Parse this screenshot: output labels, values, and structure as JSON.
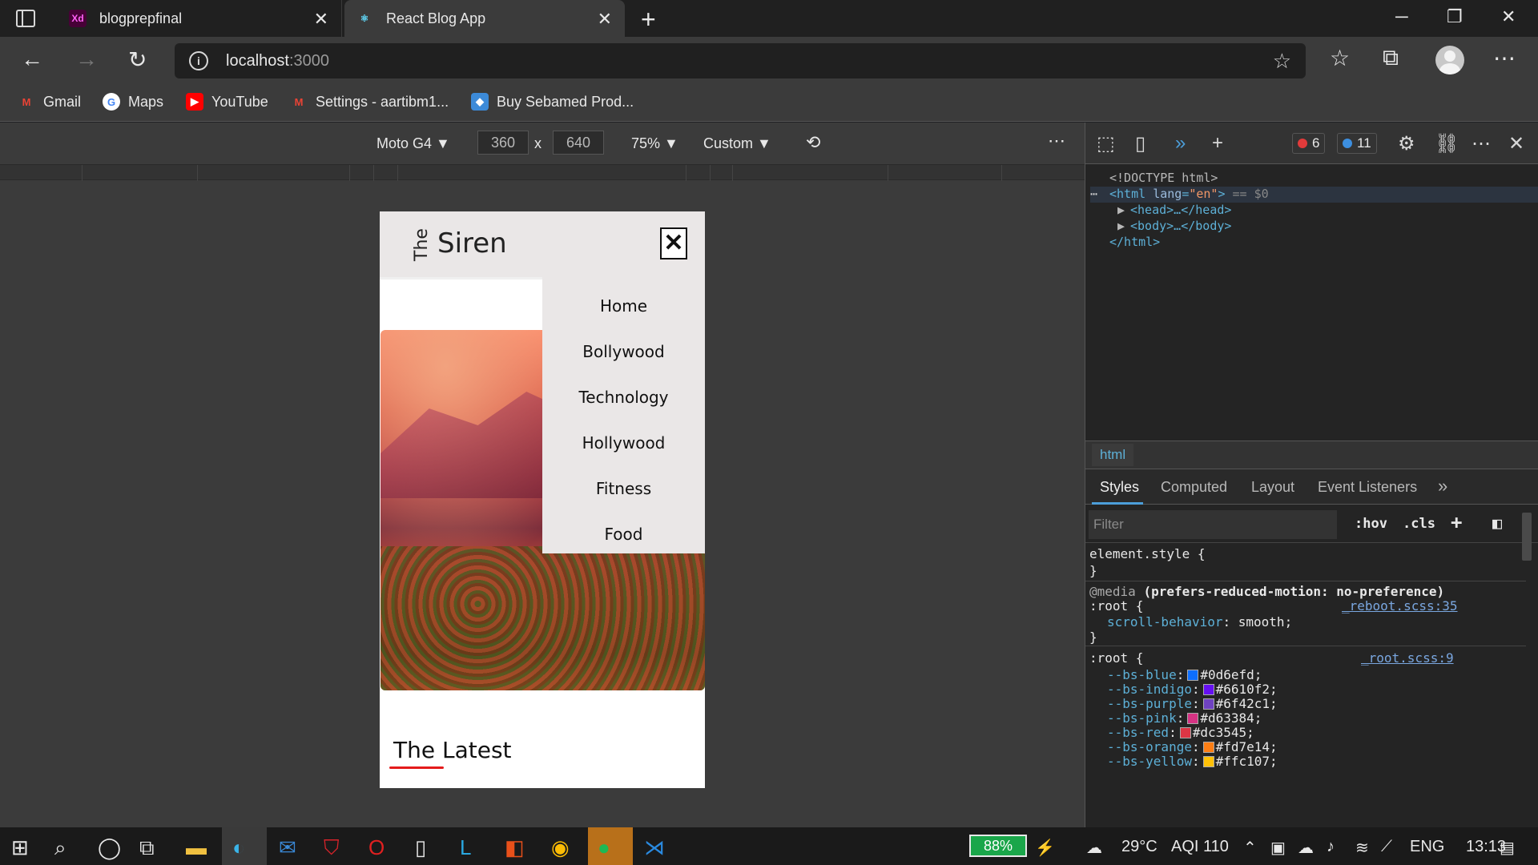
{
  "browser": {
    "tabs": [
      {
        "label": "blogprepfinal",
        "icon": "adobe-xd-icon",
        "icon_text": "Xd"
      },
      {
        "label": "React Blog App",
        "icon": "react-icon"
      }
    ],
    "url_host": "localhost",
    "url_port": ":3000",
    "bookmarks": [
      {
        "label": "Gmail",
        "icon": "gmail-icon"
      },
      {
        "label": "Maps",
        "icon": "google-icon"
      },
      {
        "label": "YouTube",
        "icon": "youtube-icon"
      },
      {
        "label": "Settings - aartibm1...",
        "icon": "gmail-icon"
      },
      {
        "label": "Buy Sebamed Prod...",
        "icon": "shop-icon"
      }
    ]
  },
  "device_toolbar": {
    "device": "Moto G4",
    "width": "360",
    "height": "640",
    "zoom": "75%",
    "throttle": "Custom"
  },
  "page": {
    "logo_the": "The",
    "logo_siren": "Siren",
    "close_symbol": "✕",
    "menu_items": [
      "Home",
      "Bollywood",
      "Technology",
      "Hollywood",
      "Fitness",
      "Food"
    ],
    "section_title": "The Latest"
  },
  "devtools": {
    "error_count": "6",
    "message_count": "11",
    "dom": {
      "doctype": "<!DOCTYPE html>",
      "html_open_tag": "<html",
      "html_attr_name": "lang",
      "html_attr_value": "\"en\"",
      "html_close_bracket": ">",
      "selected_marker": "== $0",
      "head": "<head>…</head>",
      "body": "<body>…</body>",
      "html_close": "</html>"
    },
    "breadcrumb": "html",
    "subtabs": [
      "Styles",
      "Computed",
      "Layout",
      "Event Listeners"
    ],
    "filter_placeholder": "Filter",
    "hov": ":hov",
    "cls": ".cls",
    "styles": {
      "element_style": "element.style {",
      "close_brace": "}",
      "media_at": "@media",
      "media_query": "(prefers-reduced-motion: no-preference)",
      "root_selector": ":root {",
      "reboot_link": "_reboot.scss:35",
      "scroll_prop": "scroll-behavior",
      "scroll_val": "smooth;",
      "root_link": "_root.scss:9",
      "vars": [
        {
          "name": "--bs-blue",
          "value": "#0d6efd;",
          "color": "#0d6efd"
        },
        {
          "name": "--bs-indigo",
          "value": "#6610f2;",
          "color": "#6610f2"
        },
        {
          "name": "--bs-purple",
          "value": "#6f42c1;",
          "color": "#6f42c1"
        },
        {
          "name": "--bs-pink",
          "value": "#d63384;",
          "color": "#d63384"
        },
        {
          "name": "--bs-red",
          "value": "#dc3545;",
          "color": "#dc3545"
        },
        {
          "name": "--bs-orange",
          "value": "#fd7e14;",
          "color": "#fd7e14"
        },
        {
          "name": "--bs-yellow",
          "value": "#ffc107;",
          "color": "#ffc107"
        }
      ]
    }
  },
  "taskbar": {
    "battery": "88%",
    "weather": "29°C",
    "aqi": "AQI 110",
    "language": "ENG",
    "time": "13:13"
  }
}
